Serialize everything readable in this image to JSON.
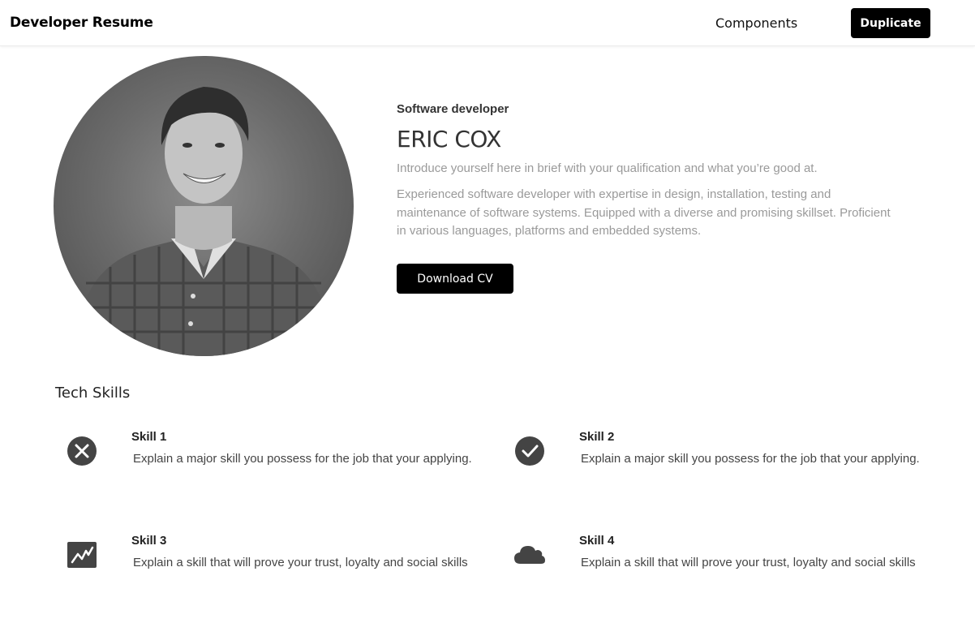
{
  "header": {
    "brand": "Developer Resume",
    "nav_components": "Components",
    "duplicate_label": "Duplicate"
  },
  "profile": {
    "photo_icon": "portrait-photo",
    "role": "Software developer",
    "name": "ERIC COX",
    "intro": "Introduce yourself here in brief with your qualification and what you’re good at.",
    "bio": "Experienced software developer with expertise in design, installation, testing and maintenance of software systems. Equipped with a diverse and promising skillset. Proficient in various languages, platforms and embedded systems.",
    "download_label": "Download CV"
  },
  "skills_section": {
    "title": "Tech Skills",
    "items": [
      {
        "icon": "x-circle-icon",
        "title": "Skill 1",
        "description": "Explain a major skill you possess for the job that your applying."
      },
      {
        "icon": "check-circle-icon",
        "title": "Skill 2",
        "description": "Explain a major skill you possess for the job that your applying."
      },
      {
        "icon": "chart-icon",
        "title": "Skill 3",
        "description": "Explain a skill that will prove your trust, loyalty and social skills"
      },
      {
        "icon": "cloud-icon",
        "title": "Skill 4",
        "description": "Explain a skill that will prove your trust, loyalty and social skills"
      }
    ]
  },
  "colors": {
    "accent": "#000000",
    "icon": "#444444",
    "muted_text": "#9a9a9a"
  }
}
